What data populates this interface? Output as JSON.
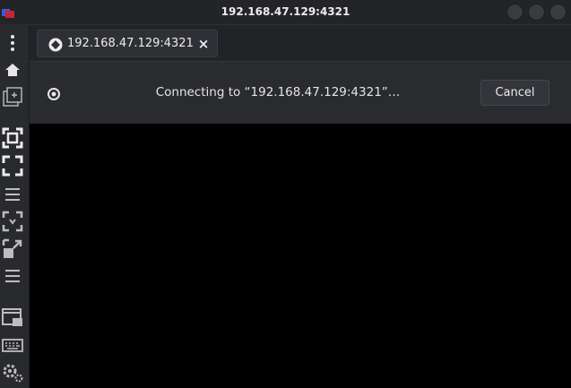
{
  "window": {
    "title": "192.168.47.129:4321",
    "app_icon": "red-blue-window-icon",
    "buttons": [
      "minimize",
      "maximize",
      "close"
    ]
  },
  "sidebar": {
    "items": [
      {
        "name": "menu-dots-icon"
      },
      {
        "name": "home-icon"
      },
      {
        "name": "new-connection-icon"
      },
      {
        "name": "fit-window-icon"
      },
      {
        "name": "fullscreen-icon"
      },
      {
        "name": "list-icon"
      },
      {
        "name": "scale-view-icon"
      },
      {
        "name": "resize-view-icon"
      },
      {
        "name": "list-icon-2"
      },
      {
        "name": "display-window-icon"
      },
      {
        "name": "keyboard-icon"
      },
      {
        "name": "settings-icon"
      }
    ]
  },
  "tab": {
    "label": "192.168.47.129:4321",
    "close_glyph": "×"
  },
  "notice": {
    "message": "Connecting to “192.168.47.129:4321”…",
    "cancel_label": "Cancel"
  },
  "colors": {
    "titlebar": "#232427",
    "sidebar": "#292a2e",
    "notice_bar": "#2a2b2f",
    "display": "#000000"
  }
}
